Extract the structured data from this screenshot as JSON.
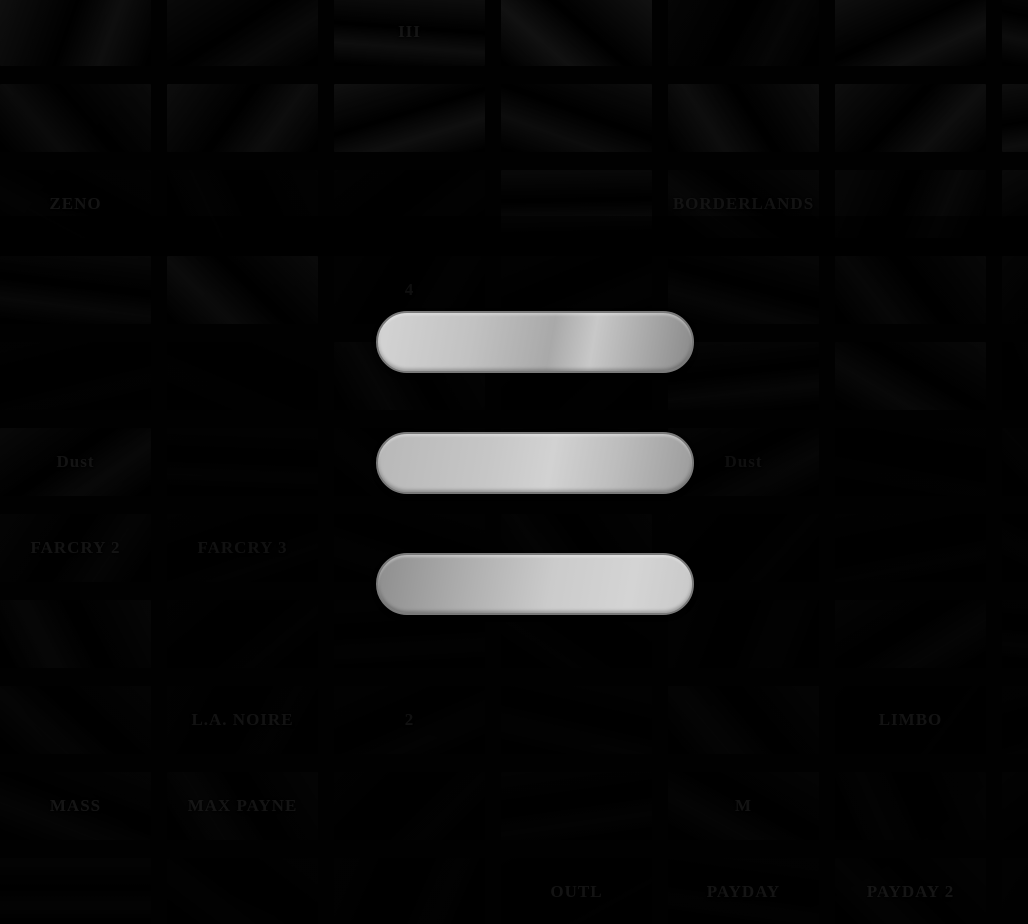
{
  "background": {
    "color": "#020202",
    "tiles": [
      {
        "title": "",
        "color": "#3a3a3a"
      },
      {
        "title": "",
        "color": "#2b2b2b"
      },
      {
        "title": "III",
        "color": "#3c3c3c"
      },
      {
        "title": "",
        "color": "#4a4a4a"
      },
      {
        "title": "",
        "color": "#1f1f1f"
      },
      {
        "title": "",
        "color": "#3f3f3f"
      },
      {
        "title": "",
        "color": "#333333"
      },
      {
        "title": "",
        "color": "#2e2e2e"
      },
      {
        "title": "",
        "color": "#3a3a3a"
      },
      {
        "title": "",
        "color": "#464646"
      },
      {
        "title": "",
        "color": "#3a3a3a"
      },
      {
        "title": "",
        "color": "#3e3e3e"
      },
      {
        "title": "",
        "color": "#3c3c3c"
      },
      {
        "title": "",
        "color": "#383838"
      },
      {
        "title": "ZENO",
        "color": "#151515"
      },
      {
        "title": "",
        "color": "#151515"
      },
      {
        "title": "",
        "color": "#151515"
      },
      {
        "title": "",
        "color": "#2f2f2f"
      },
      {
        "title": "BORDERLANDS",
        "color": "#262626"
      },
      {
        "title": "",
        "color": "#262626"
      },
      {
        "title": "",
        "color": "#2c2c2c"
      },
      {
        "title": "",
        "color": "#262626"
      },
      {
        "title": "",
        "color": "#363636"
      },
      {
        "title": "4",
        "color": "#151515"
      },
      {
        "title": "",
        "color": "#161616"
      },
      {
        "title": "",
        "color": "#262626"
      },
      {
        "title": "",
        "color": "#262626"
      },
      {
        "title": "",
        "color": "#1e1e1e"
      },
      {
        "title": "",
        "color": "#111111"
      },
      {
        "title": "",
        "color": "#111111"
      },
      {
        "title": "",
        "color": "#262626"
      },
      {
        "title": "",
        "color": "#111111"
      },
      {
        "title": "",
        "color": "#262626"
      },
      {
        "title": "",
        "color": "#2a2a2a"
      },
      {
        "title": "",
        "color": "#111111"
      },
      {
        "title": "Dust",
        "color": "#2a2a2a"
      },
      {
        "title": "",
        "color": "#151515"
      },
      {
        "title": "",
        "color": "#151515"
      },
      {
        "title": "",
        "color": "#151515"
      },
      {
        "title": "Dust",
        "color": "#242424"
      },
      {
        "title": "",
        "color": "#111111"
      },
      {
        "title": "",
        "color": "#151515"
      },
      {
        "title": "FARCRY 2",
        "color": "#1c1c1c"
      },
      {
        "title": "FARCRY 3",
        "color": "#121212"
      },
      {
        "title": "",
        "color": "#161616"
      },
      {
        "title": "",
        "color": "#1f1f1f"
      },
      {
        "title": "",
        "color": "#121212"
      },
      {
        "title": "",
        "color": "#121212"
      },
      {
        "title": "",
        "color": "#121212"
      },
      {
        "title": "",
        "color": "#222222"
      },
      {
        "title": "",
        "color": "#121212"
      },
      {
        "title": "",
        "color": "#161616"
      },
      {
        "title": "",
        "color": "#121212"
      },
      {
        "title": "",
        "color": "#161616"
      },
      {
        "title": "",
        "color": "#1c1c1c"
      },
      {
        "title": "",
        "color": "#161616"
      },
      {
        "title": "",
        "color": "#1c1c1c"
      },
      {
        "title": "L.A. NOIRE",
        "color": "#121212"
      },
      {
        "title": "2",
        "color": "#161616"
      },
      {
        "title": "",
        "color": "#161616"
      },
      {
        "title": "",
        "color": "#1e1e1e"
      },
      {
        "title": "LIMBO",
        "color": "#0e0e0e"
      },
      {
        "title": "",
        "color": "#121212"
      },
      {
        "title": "MASS",
        "color": "#1a1a1a"
      },
      {
        "title": "MAX PAYNE",
        "color": "#1c1c1c"
      },
      {
        "title": "",
        "color": "#121212"
      },
      {
        "title": "",
        "color": "#161616"
      },
      {
        "title": "M",
        "color": "#1c1c1c"
      },
      {
        "title": "",
        "color": "#161616"
      },
      {
        "title": "",
        "color": "#141414"
      },
      {
        "title": "",
        "color": "#161616"
      },
      {
        "title": "",
        "color": "#121212"
      },
      {
        "title": "",
        "color": "#121212"
      },
      {
        "title": "OUTL",
        "color": "#0e0e0e"
      },
      {
        "title": "PAYDAY",
        "color": "#121212"
      },
      {
        "title": "PAYDAY 2",
        "color": "#161616"
      },
      {
        "title": "",
        "color": "#121212"
      }
    ]
  },
  "menu": {
    "bar_light": "#d4d4d4",
    "bar_dark": "#8a8a8a",
    "bar_border": "#7a7a7a"
  }
}
